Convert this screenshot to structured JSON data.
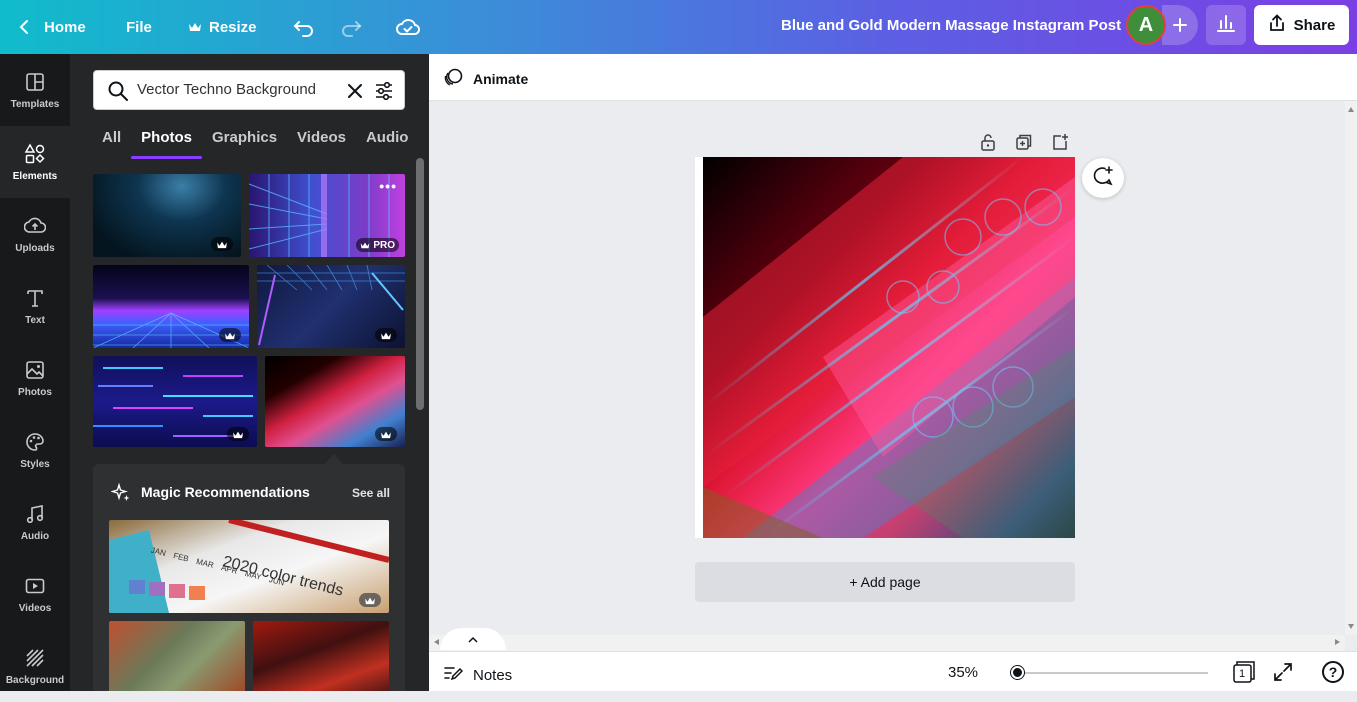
{
  "topbar": {
    "home_label": "Home",
    "file_label": "File",
    "resize_label": "Resize",
    "design_title": "Blue and Gold Modern Massage Instagram Post",
    "avatar_letter": "A",
    "share_label": "Share"
  },
  "sidenav": {
    "items": [
      {
        "label": "Templates",
        "icon": "templates-icon"
      },
      {
        "label": "Elements",
        "icon": "elements-icon"
      },
      {
        "label": "Uploads",
        "icon": "uploads-icon"
      },
      {
        "label": "Text",
        "icon": "text-icon"
      },
      {
        "label": "Photos",
        "icon": "photos-icon"
      },
      {
        "label": "Styles",
        "icon": "styles-icon"
      },
      {
        "label": "Audio",
        "icon": "audio-icon"
      },
      {
        "label": "Videos",
        "icon": "videos-icon"
      },
      {
        "label": "Background",
        "icon": "background-icon"
      }
    ],
    "active": "Elements"
  },
  "panel": {
    "search_value": "Vector Techno Background",
    "tabs": [
      "All",
      "Photos",
      "Graphics",
      "Videos",
      "Audio"
    ],
    "active_tab": "Photos",
    "pro_label": "PRO",
    "magic_title": "Magic Recommendations",
    "see_all": "See all",
    "calendar_text": "2020 color trends",
    "calendar_months": [
      "JAN",
      "FEB",
      "MAR",
      "APR",
      "MAY",
      "JUN"
    ]
  },
  "editor": {
    "animate_label": "Animate",
    "add_page_label": "+ Add page",
    "notes_label": "Notes",
    "zoom": "35%",
    "page_count": "1",
    "help_label": "?"
  },
  "colors": {
    "accent": "#8b3dff",
    "sidenav_bg": "#18191b",
    "panel_bg": "#252627"
  }
}
